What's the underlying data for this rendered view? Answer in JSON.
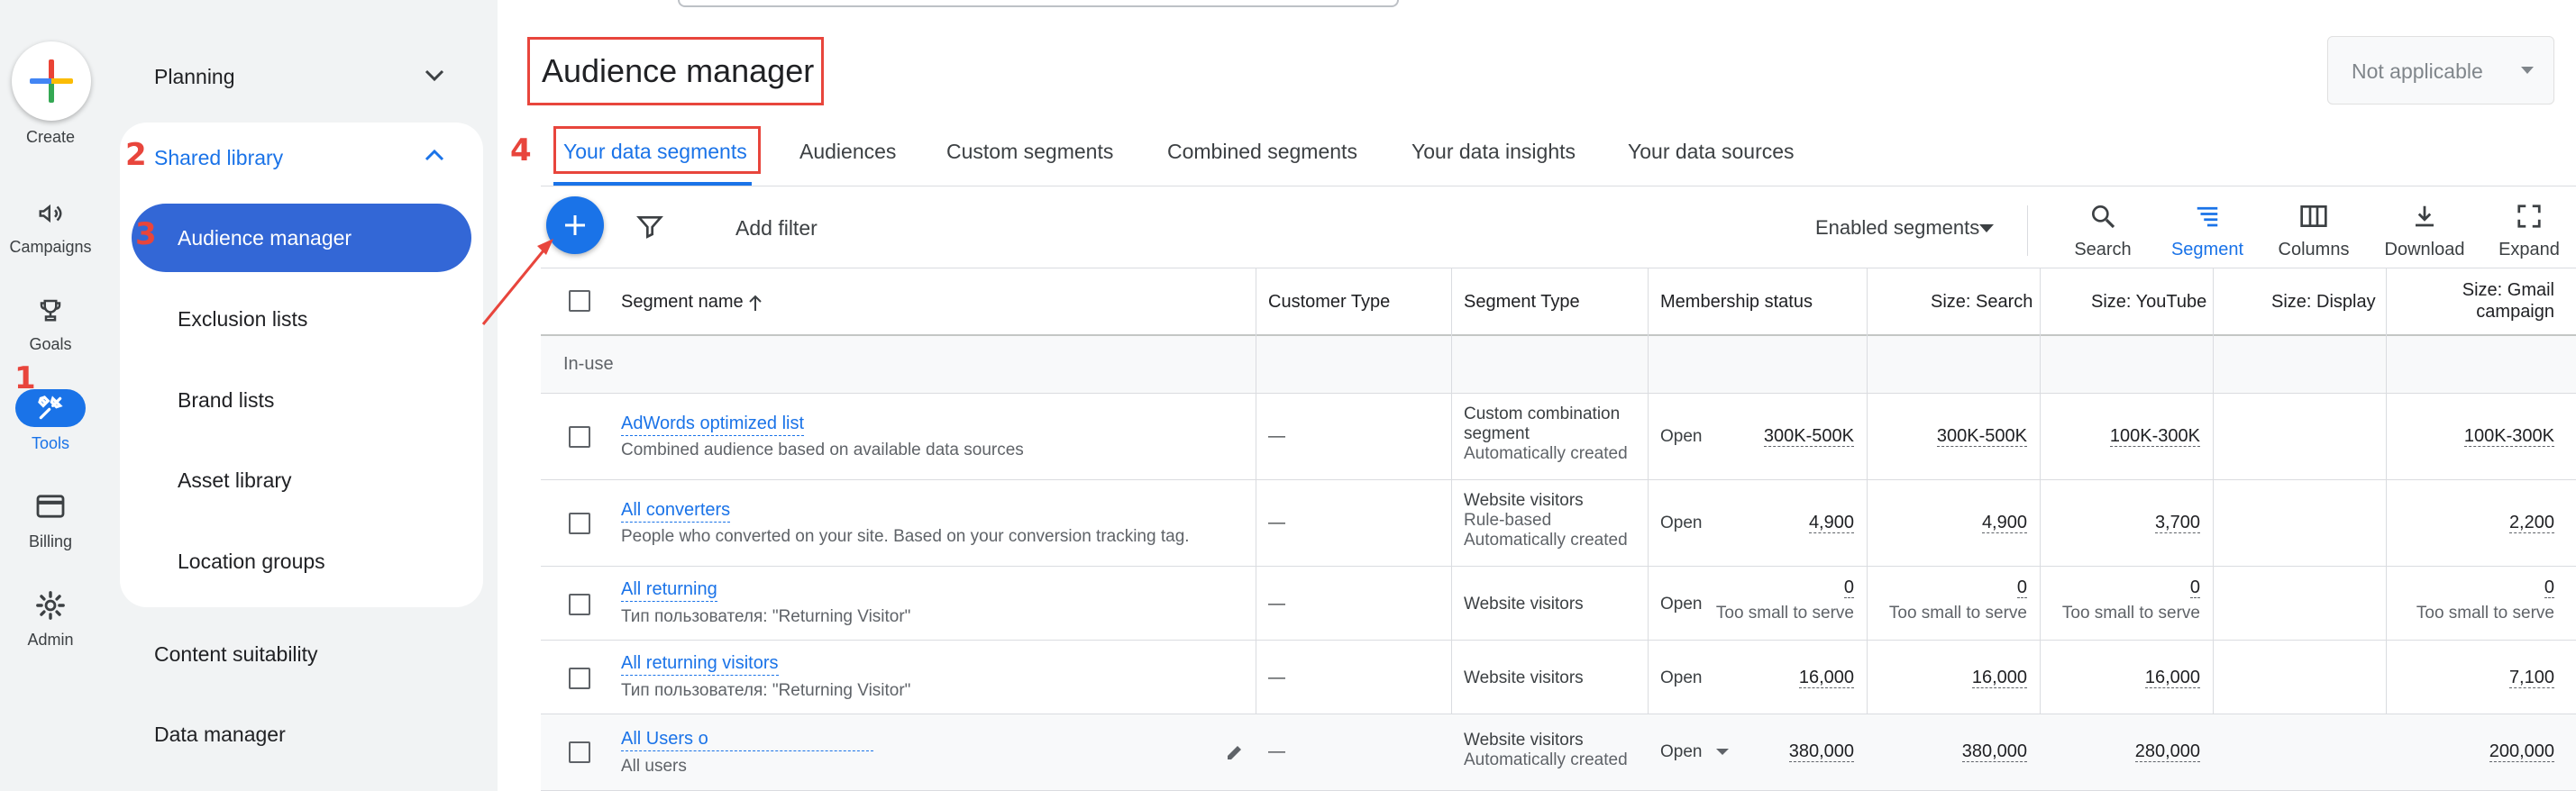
{
  "rail": {
    "create": "Create",
    "items": [
      {
        "label": "Campaigns",
        "icon": "campaigns-icon"
      },
      {
        "label": "Goals",
        "icon": "trophy-icon"
      },
      {
        "label": "Tools",
        "icon": "tools-icon"
      },
      {
        "label": "Billing",
        "icon": "billing-card-icon"
      },
      {
        "label": "Admin",
        "icon": "gear-icon"
      }
    ]
  },
  "subnav": {
    "planning": "Planning",
    "shared_library": "Shared library",
    "children": [
      "Audience manager",
      "Exclusion lists",
      "Brand lists",
      "Asset library",
      "Location groups"
    ],
    "content_suitability": "Content suitability",
    "data_manager": "Data manager"
  },
  "annotations": {
    "n1": "1",
    "n2": "2",
    "n3": "3",
    "n4": "4"
  },
  "header": {
    "title": "Audience manager",
    "account_select": "Not applicable"
  },
  "tabs": [
    "Your data segments",
    "Audiences",
    "Custom segments",
    "Combined segments",
    "Your data insights",
    "Your data sources"
  ],
  "toolbar": {
    "add_filter": "Add filter",
    "enabled_segments": "Enabled segments",
    "buttons": [
      {
        "label": "Search",
        "icon": "search-icon"
      },
      {
        "label": "Segment",
        "icon": "segment-icon"
      },
      {
        "label": "Columns",
        "icon": "columns-icon"
      },
      {
        "label": "Download",
        "icon": "download-icon"
      },
      {
        "label": "Expand",
        "icon": "expand-icon"
      }
    ]
  },
  "table": {
    "headers": {
      "name": "Segment name",
      "customer_type": "Customer Type",
      "segment_type": "Segment Type",
      "membership": "Membership status",
      "size_search": "Size: Search",
      "size_youtube": "Size: YouTube",
      "size_display": "Size: Display",
      "size_gmail_1": "Size: Gmail",
      "size_gmail_2": "campaign"
    },
    "group": "In-use",
    "rows": [
      {
        "name": "AdWords optimized list",
        "desc": "Combined audience based on available data sources",
        "customer": "—",
        "type": [
          "Custom combination",
          "segment",
          "Automatically created"
        ],
        "membership": "Open",
        "sizes": [
          "300K-500K",
          "300K-500K",
          "100K-300K",
          "100K-300K"
        ],
        "size_note": ""
      },
      {
        "name": "All converters",
        "desc": "People who converted on your site. Based on your conversion tracking tag.",
        "customer": "—",
        "type": [
          "Website visitors",
          "Rule-based",
          "Automatically created"
        ],
        "membership": "Open",
        "sizes": [
          "4,900",
          "4,900",
          "3,700",
          "2,200"
        ],
        "size_note": ""
      },
      {
        "name": "All returning",
        "desc": "Тип пользователя: \"Returning Visitor\"",
        "customer": "—",
        "type": [
          "Website visitors"
        ],
        "membership": "Open",
        "sizes": [
          "0",
          "0",
          "0",
          "0"
        ],
        "size_note": "Too small to serve"
      },
      {
        "name": "All returning visitors",
        "desc": "Тип пользователя: \"Returning Visitor\"",
        "customer": "—",
        "type": [
          "Website visitors"
        ],
        "membership": "Open",
        "sizes": [
          "16,000",
          "16,000",
          "16,000",
          "7,100"
        ],
        "size_note": ""
      },
      {
        "name": "All Users o",
        "desc": "All users",
        "customer": "—",
        "type": [
          "Website visitors",
          "Automatically created"
        ],
        "membership": "Open",
        "sizes": [
          "380,000",
          "380,000",
          "280,000",
          "200,000"
        ],
        "size_note": ""
      }
    ]
  },
  "colors": {
    "accent": "#1a73e8",
    "annotation": "#e8453c",
    "active_nav": "#3367d6"
  }
}
